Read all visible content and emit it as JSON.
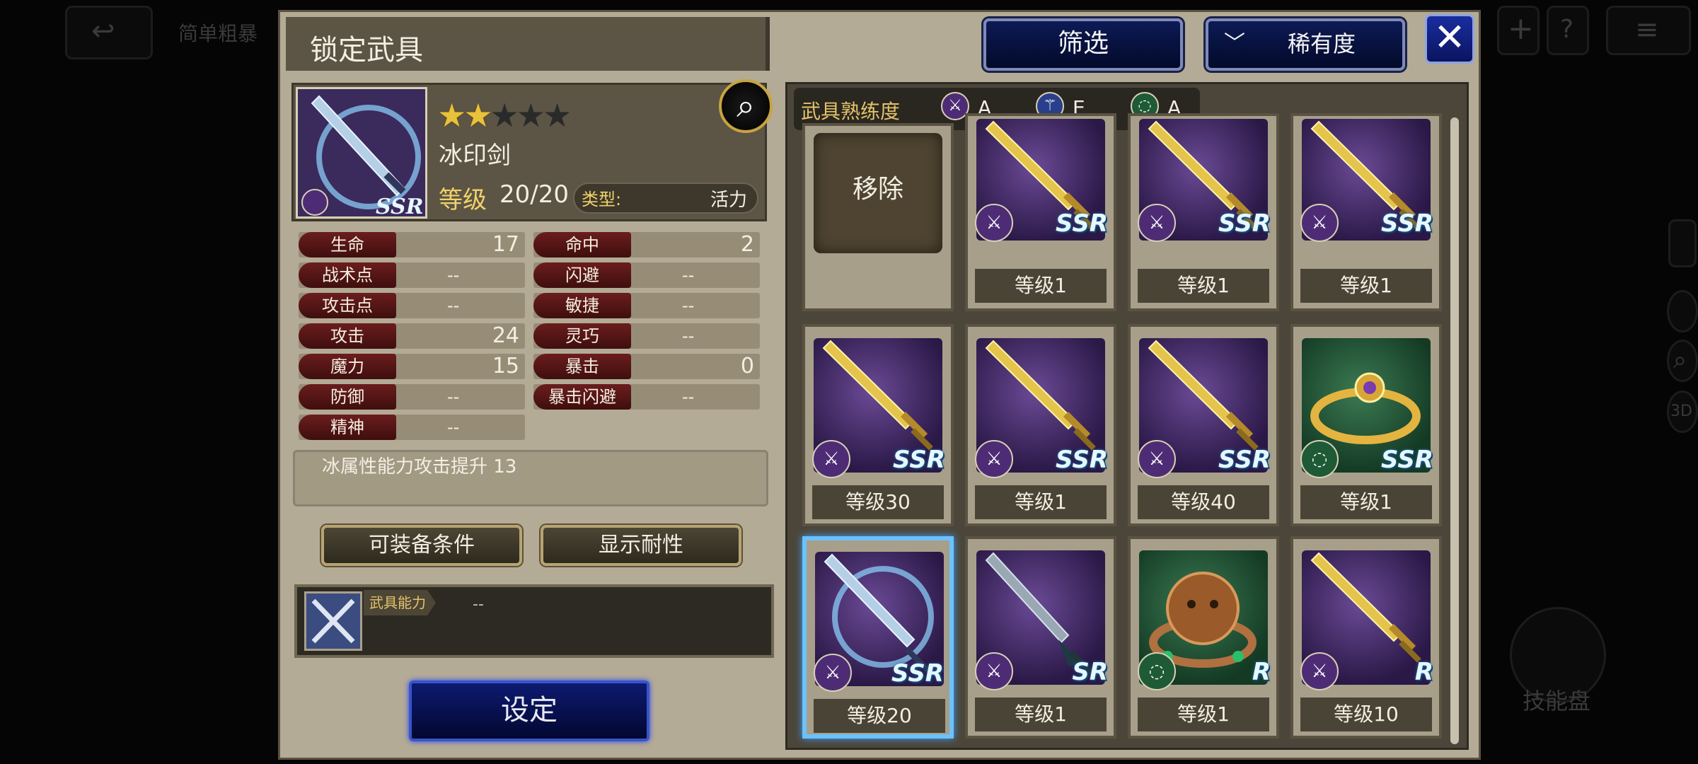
{
  "background": {
    "top_label": "简单粗暴",
    "skill_label": "技能盘",
    "side_labels": [
      "3D"
    ]
  },
  "header": {
    "title": "锁定武具",
    "filter_label": "筛选",
    "sort_label": "稀有度",
    "close_label": "✕"
  },
  "item": {
    "name": "冰印剑",
    "stars_filled": 2,
    "stars_total": 5,
    "level_label": "等级",
    "level_value": "20/20",
    "type_label": "类型:",
    "type_value": "活力",
    "rarity": "SSR"
  },
  "stats_left": [
    {
      "label": "生命",
      "value": "17"
    },
    {
      "label": "战术点",
      "value": "--"
    },
    {
      "label": "攻击点",
      "value": "--"
    },
    {
      "label": "攻击",
      "value": "24"
    },
    {
      "label": "魔力",
      "value": "15"
    },
    {
      "label": "防御",
      "value": "--"
    },
    {
      "label": "精神",
      "value": "--"
    }
  ],
  "stats_right": [
    {
      "label": "命中",
      "value": "2"
    },
    {
      "label": "闪避",
      "value": "--"
    },
    {
      "label": "敏捷",
      "value": "--"
    },
    {
      "label": "灵巧",
      "value": "--"
    },
    {
      "label": "暴击",
      "value": "0"
    },
    {
      "label": "暴击闪避",
      "value": "--"
    }
  ],
  "ability_desc": "冰属性能力攻击提升 13",
  "buttons": {
    "equip_conditions": "可装备条件",
    "show_resistance": "显示耐性",
    "set": "设定"
  },
  "weapon_ability": {
    "label": "武具能力",
    "value": "--"
  },
  "mastery": {
    "label": "武具熟练度",
    "entries": [
      {
        "icon": "sword-icon",
        "grade": "A",
        "color": "#4e2c75"
      },
      {
        "icon": "staff-icon",
        "grade": "E",
        "color": "#2a3f8a"
      },
      {
        "icon": "ring-icon",
        "grade": "A",
        "color": "#1e5a36"
      }
    ]
  },
  "grid": {
    "remove_label": "移除",
    "cards": [
      {
        "level": "等级1",
        "kind": "gold-sword",
        "rarity": "SSR",
        "cat": "sword"
      },
      {
        "level": "等级1",
        "kind": "gold-sword",
        "rarity": "SSR",
        "cat": "sword"
      },
      {
        "level": "等级1",
        "kind": "gold-sword",
        "rarity": "SSR",
        "cat": "sword"
      },
      {
        "level": "等级30",
        "kind": "gold-sword",
        "rarity": "SSR",
        "cat": "sword"
      },
      {
        "level": "等级1",
        "kind": "gold-sword",
        "rarity": "SSR",
        "cat": "sword"
      },
      {
        "level": "等级40",
        "kind": "gold-sword",
        "rarity": "SSR",
        "cat": "sword"
      },
      {
        "level": "等级1",
        "kind": "gold-ring",
        "rarity": "SSR",
        "cat": "ring"
      },
      {
        "level": "等级20",
        "kind": "ice-sword",
        "rarity": "SSR",
        "cat": "sword",
        "selected": true
      },
      {
        "level": "等级1",
        "kind": "dark-sword",
        "rarity": "SR",
        "cat": "sword"
      },
      {
        "level": "等级1",
        "kind": "lion-ring",
        "rarity": "R",
        "cat": "ring"
      },
      {
        "level": "等级10",
        "kind": "gold-sword-plain",
        "rarity": "R",
        "cat": "sword"
      }
    ]
  }
}
